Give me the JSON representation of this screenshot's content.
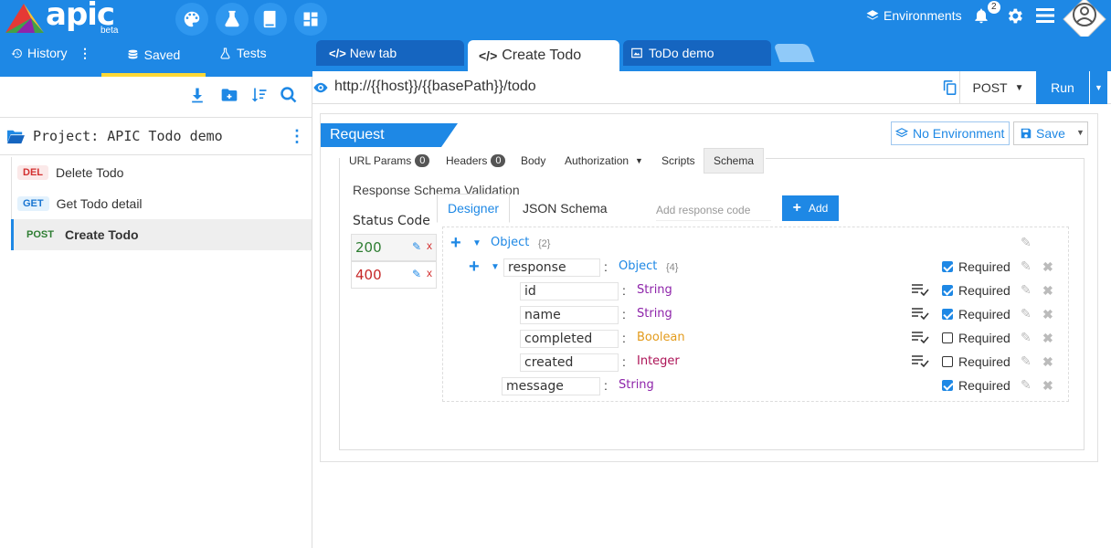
{
  "brand": {
    "name": "apic",
    "tag": "beta"
  },
  "header": {
    "environments_label": "Environments",
    "notifications_count": "2"
  },
  "sidebar": {
    "tabs": [
      {
        "label": "History"
      },
      {
        "label": "Saved"
      },
      {
        "label": "Tests"
      }
    ],
    "project_title": "Project: APIC Todo demo",
    "items": [
      {
        "method": "DEL",
        "name": "Delete Todo",
        "color": "#d32f2f"
      },
      {
        "method": "GET",
        "name": "Get Todo detail",
        "color": "#1976d2"
      },
      {
        "method": "POST",
        "name": "Create Todo",
        "color": "#2e7d32"
      }
    ]
  },
  "tabs": [
    {
      "label": "New tab"
    },
    {
      "label": "Create Todo"
    },
    {
      "label": "ToDo demo"
    }
  ],
  "url_bar": {
    "url": "http://{{host}}/{{basePath}}/todo",
    "method": "POST",
    "run_label": "Run"
  },
  "request": {
    "title": "Request",
    "no_env_label": "No Environment",
    "save_label": "Save",
    "subtabs": [
      {
        "label": "URL Params",
        "badge": "0"
      },
      {
        "label": "Headers",
        "badge": "0"
      },
      {
        "label": "Body"
      },
      {
        "label": "Authorization"
      },
      {
        "label": "Scripts"
      },
      {
        "label": "Schema"
      }
    ]
  },
  "schema": {
    "section_title": "Response Schema Validation",
    "status_code_label": "Status Code",
    "codes": [
      {
        "code": "200",
        "color": "#2e7d32"
      },
      {
        "code": "400",
        "color": "#c62828"
      }
    ],
    "mode_tabs": [
      {
        "label": "Designer"
      },
      {
        "label": "JSON Schema"
      }
    ],
    "add_code_placeholder": "Add response code",
    "add_label": "Add",
    "root": {
      "type": "Object",
      "count": "{2}"
    },
    "properties": [
      {
        "name": "response",
        "type": "Object",
        "count": "{4}",
        "type_color": "#1e88e5",
        "required": true
      },
      {
        "name": "id",
        "type": "String",
        "type_color": "#8e24aa",
        "required": true
      },
      {
        "name": "name",
        "type": "String",
        "type_color": "#8e24aa",
        "required": true
      },
      {
        "name": "completed",
        "type": "Boolean",
        "type_color": "#e39b1c",
        "required": false
      },
      {
        "name": "created",
        "type": "Integer",
        "type_color": "#ad1457",
        "required": false
      },
      {
        "name": "message",
        "type": "String",
        "type_color": "#8e24aa",
        "required": true
      }
    ],
    "required_label": "Required"
  }
}
